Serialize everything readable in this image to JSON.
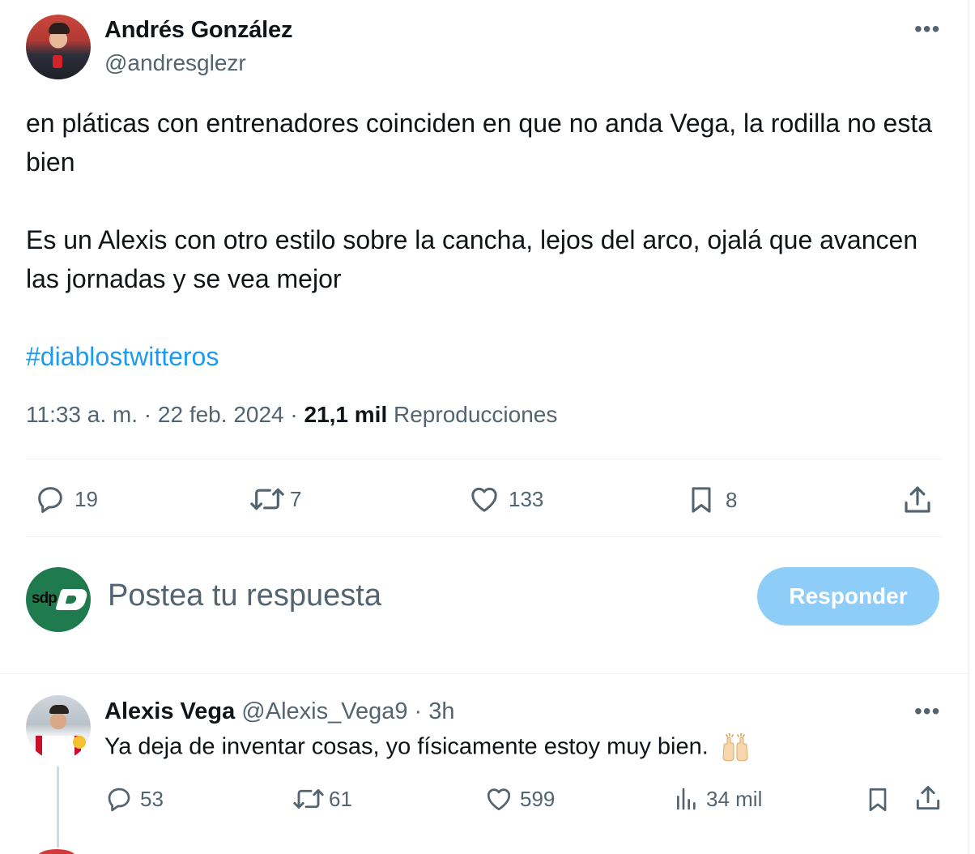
{
  "colors": {
    "text_primary": "#0f1419",
    "text_secondary": "#536471",
    "link": "#1d9bf0",
    "reply_button_disabled": "#8ecdf8",
    "divider": "#eff3f4"
  },
  "tweet": {
    "author_name": "Andrés González",
    "author_handle": "@andresglezr",
    "more_icon": "more-horizontal-icon",
    "text_p1": "en pláticas con entrenadores coinciden en que no anda Vega, la rodilla no esta bien",
    "text_p2": "Es un Alexis con otro estilo sobre la cancha, lejos del arco, ojalá que avancen las jornadas y se vea mejor",
    "hashtag": "#diablostwitteros",
    "time": "11:33 a. m.",
    "date": "22 feb. 2024",
    "views_count": "21,1 mil",
    "views_label": "Reproducciones",
    "actions": {
      "replies": "19",
      "retweets": "7",
      "likes": "133",
      "bookmarks": "8"
    }
  },
  "composer": {
    "avatar_text": "sdp",
    "placeholder": "Postea tu respuesta",
    "button_label": "Responder"
  },
  "reply": {
    "author_name": "Alexis Vega",
    "meta": "@Alexis_Vega9 · 3h",
    "text": "Ya deja de inventar cosas, yo físicamente estoy muy bien.",
    "emoji_icon": "raising-hands-icon",
    "actions": {
      "replies": "53",
      "retweets": "61",
      "likes": "599",
      "views": "34 mil"
    }
  }
}
